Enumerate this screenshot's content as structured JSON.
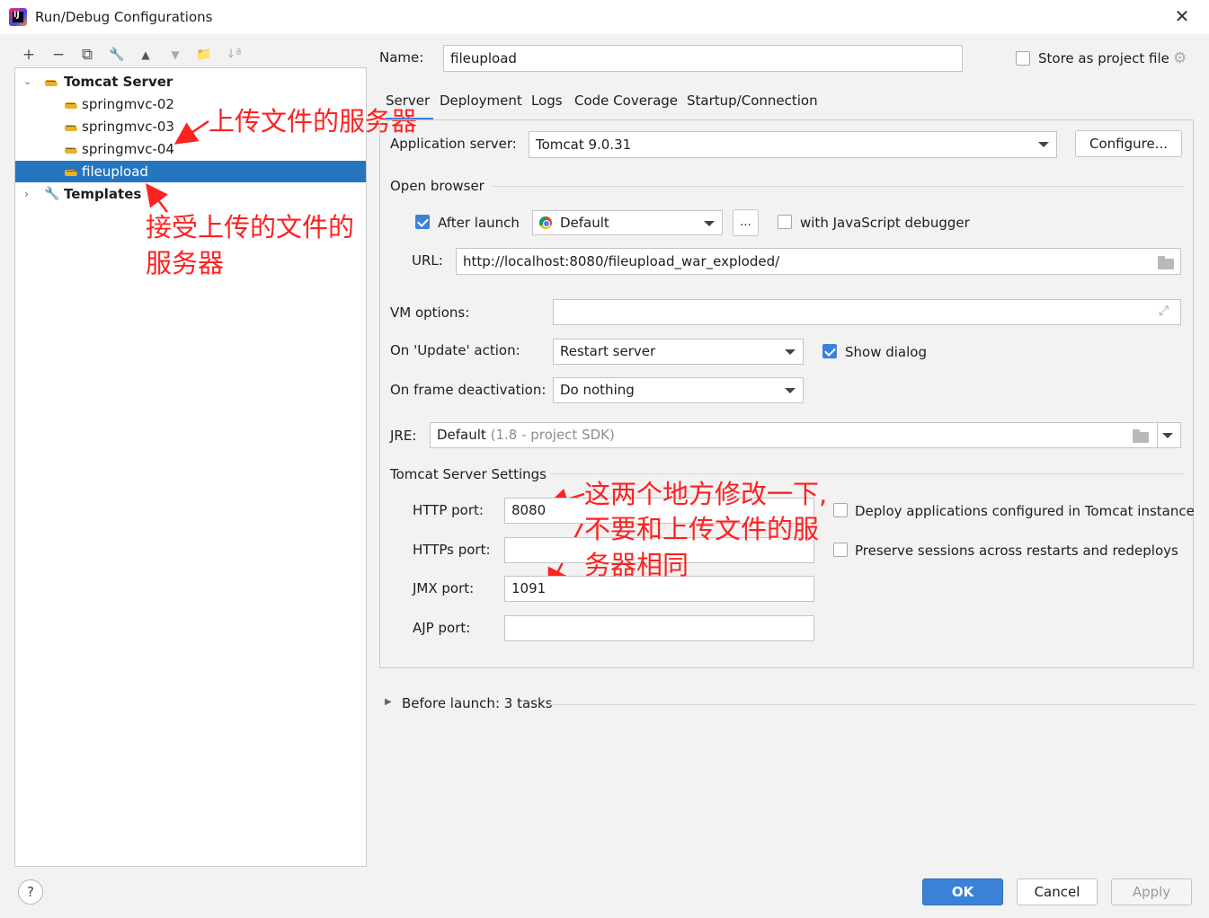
{
  "window": {
    "title": "Run/Debug Configurations",
    "close_icon": "close-icon"
  },
  "toolbar": {
    "add": "+",
    "remove": "−",
    "copy": "⧉",
    "edit": "🔧",
    "up": "▲",
    "down": "▼",
    "folder": "📁",
    "sort": "↓ª"
  },
  "tree": {
    "group": "Tomcat Server",
    "items": [
      "springmvc-02",
      "springmvc-03",
      "springmvc-04",
      "fileupload"
    ],
    "templates": "Templates"
  },
  "annotations": {
    "a1": "上传文件的服务器",
    "a2_line1": "接受上传的文件的",
    "a2_line2": "服务器",
    "a3_line1": "这两个地方修改一下,",
    "a3_line2": "不要和上传文件的服",
    "a3_line3": "务器相同"
  },
  "name_label": "Name:",
  "name_value": "fileupload",
  "store_label": "Store as project file",
  "tabs": [
    "Server",
    "Deployment",
    "Logs",
    "Code Coverage",
    "Startup/Connection"
  ],
  "server": {
    "app_server_label": "Application server:",
    "app_server_value": "Tomcat 9.0.31",
    "configure": "Configure...",
    "open_browser": "Open browser",
    "after_launch": "After launch",
    "browser": "Default",
    "ellipsis": "...",
    "js_debugger": "with JavaScript debugger",
    "url_label": "URL:",
    "url_value": "http://localhost:8080/fileupload_war_exploded/",
    "vm_label": "VM options:",
    "update_label": "On 'Update' action:",
    "update_value": "Restart server",
    "show_dialog": "Show dialog",
    "frame_label": "On frame deactivation:",
    "frame_value": "Do nothing",
    "jre_label": "JRE:",
    "jre_value": "Default",
    "jre_hint": "(1.8 - project SDK)",
    "tomcat_settings": "Tomcat Server Settings",
    "http_label": "HTTP port:",
    "http_value": "8080",
    "https_label": "HTTPs port:",
    "https_value": "",
    "jmx_label": "JMX port:",
    "jmx_value": "1091",
    "ajp_label": "AJP port:",
    "ajp_value": "",
    "deploy_apps": "Deploy applications configured in Tomcat instance",
    "preserve_sessions": "Preserve sessions across restarts and redeploys"
  },
  "before_launch": "Before launch: 3 tasks",
  "buttons": {
    "help": "?",
    "ok": "OK",
    "cancel": "Cancel",
    "apply": "Apply"
  },
  "colors": {
    "accent": "#3b82d6",
    "selection": "#2675bf",
    "annotation": "#ff2020"
  }
}
